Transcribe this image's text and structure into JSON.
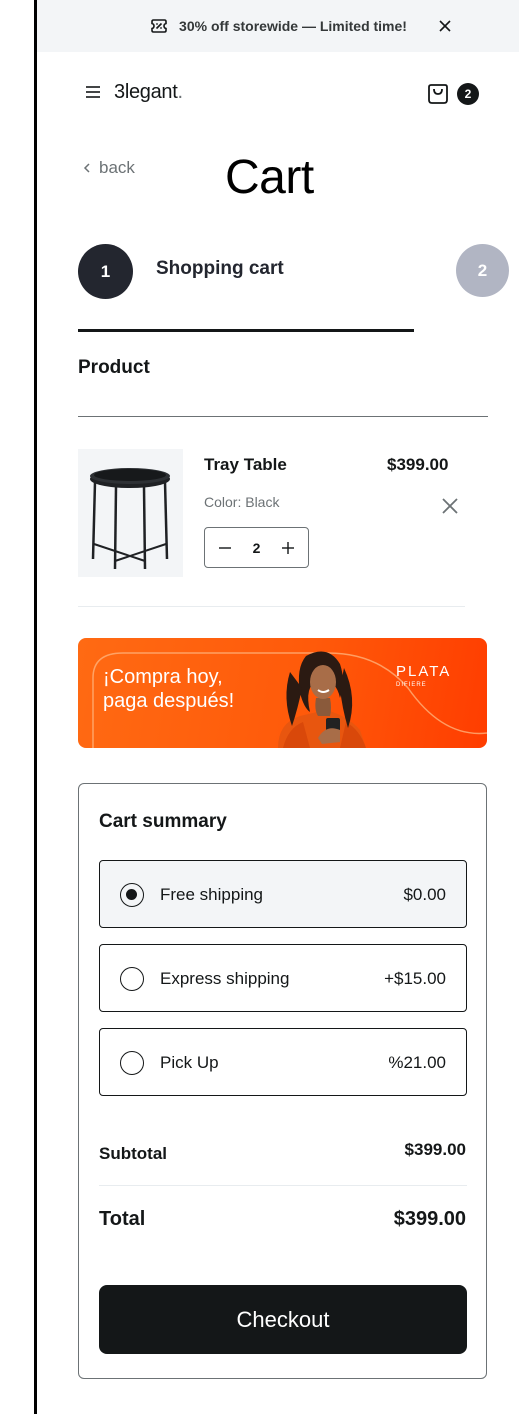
{
  "promo": {
    "text": "30% off storewide — Limited time!"
  },
  "header": {
    "logo": "3legant",
    "logo_dot": ".",
    "cart_count": "2"
  },
  "title_row": {
    "back_label": "back",
    "title": "Cart"
  },
  "steps": [
    {
      "number": "1",
      "label": "Shopping cart"
    },
    {
      "number": "2"
    }
  ],
  "product_section": {
    "header": "Product"
  },
  "cart_item": {
    "name": "Tray Table",
    "price": "$399.00",
    "color": "Color: Black",
    "quantity": "2"
  },
  "banner": {
    "line1": "¡Compra hoy,",
    "line2": "paga después!",
    "brand": "PLATA",
    "brand_sub": "DIFIERE"
  },
  "summary": {
    "title": "Cart summary",
    "options": [
      {
        "label": "Free shipping",
        "price": "$0.00",
        "selected": true
      },
      {
        "label": "Express shipping",
        "price": "+$15.00",
        "selected": false
      },
      {
        "label": "Pick Up",
        "price": "%21.00",
        "selected": false
      }
    ],
    "subtotal_label": "Subtotal",
    "subtotal_value": "$399.00",
    "total_label": "Total",
    "total_value": "$399.00",
    "checkout_label": "Checkout"
  },
  "colors": {
    "primary": "#141718",
    "muted": "#6c7275",
    "step_inactive": "#b1b5c3",
    "banner_orange": "#ff5a0a"
  },
  "icons": [
    "ticket-percent-icon",
    "close-icon",
    "hamburger-menu-icon",
    "shopping-bag-icon",
    "chevron-left-icon",
    "minus-icon",
    "plus-icon",
    "remove-item-icon"
  ]
}
